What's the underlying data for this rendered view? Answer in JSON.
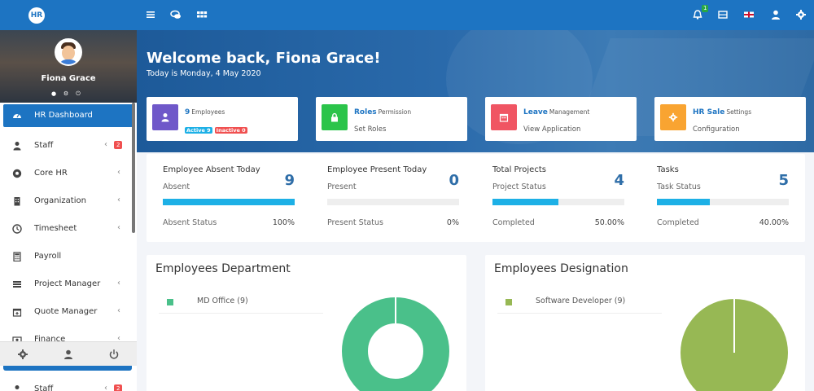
{
  "app": {
    "logo_text": "HR"
  },
  "topbar": {
    "icons": [
      "menu-icon",
      "chat-icon",
      "apps-grid-icon",
      "bell-icon",
      "layout-icon",
      "uk-flag-icon",
      "user-icon",
      "gear-icon"
    ],
    "notification_count": "1"
  },
  "user": {
    "name": "Fiona Grace"
  },
  "sidebar": {
    "items": [
      {
        "label": "HR Dashboard",
        "icon": "dashboard-icon",
        "active": true
      },
      {
        "label": "Staff",
        "icon": "user-icon",
        "badge": "2",
        "has_chevron": true
      },
      {
        "label": "Core HR",
        "icon": "soccer-icon",
        "has_chevron": true
      },
      {
        "label": "Organization",
        "icon": "building-icon",
        "has_chevron": true
      },
      {
        "label": "Timesheet",
        "icon": "clock-icon",
        "has_chevron": true
      },
      {
        "label": "Payroll",
        "icon": "calculator-icon"
      },
      {
        "label": "Project Manager",
        "icon": "tasks-icon",
        "has_chevron": true
      },
      {
        "label": "Quote Manager",
        "icon": "calendar-plus-icon",
        "has_chevron": true
      },
      {
        "label": "Finance",
        "icon": "money-icon",
        "has_chevron": true
      }
    ],
    "footer_icons": [
      "gear-icon",
      "user-icon",
      "power-icon"
    ],
    "overflow_item": {
      "label": "Staff",
      "badge": "2"
    }
  },
  "hero": {
    "welcome": "Welcome back, Fiona Grace!",
    "today": "Today is Monday, 4 May 2020"
  },
  "quick_cards": [
    {
      "title": "9",
      "title_sub": "Employees",
      "tags": [
        {
          "text": "Active 9",
          "color": "#1db0e6"
        },
        {
          "text": "Inactive 0",
          "color": "#f05050"
        }
      ],
      "icon": "user-icon",
      "color": "#6f58c9"
    },
    {
      "title": "Roles",
      "title_sub": "Permission",
      "line": "Set Roles",
      "icon": "lock-icon",
      "color": "#2bc44a"
    },
    {
      "title": "Leave",
      "title_sub": "Management",
      "line": "View Application",
      "icon": "calendar-icon",
      "color": "#f05563"
    },
    {
      "title": "HR Sale",
      "title_sub": "Settings",
      "line": "Configuration",
      "icon": "gear-icon",
      "color": "#f9a431"
    }
  ],
  "stats": [
    {
      "title": "Employee Absent Today",
      "value": "9",
      "sub": "Absent",
      "progress": 1.0,
      "foot": "Absent Status",
      "pct": "100%"
    },
    {
      "title": "Employee Present Today",
      "value": "0",
      "sub": "Present",
      "progress": 0.0,
      "foot": "Present Status",
      "pct": "0%"
    },
    {
      "title": "Total Projects",
      "value": "4",
      "sub": "Project Status",
      "progress": 0.5,
      "foot": "Completed",
      "pct": "50.00%"
    },
    {
      "title": "Tasks",
      "value": "5",
      "sub": "Task Status",
      "progress": 0.4,
      "foot": "Completed",
      "pct": "40.00%"
    }
  ],
  "panels": [
    {
      "title": "Employees Department",
      "legend": "MD Office (9)",
      "color": "#4ac08a",
      "chart": "doughnut"
    },
    {
      "title": "Employees Designation",
      "legend": "Software Developer (9)",
      "color": "#97b854",
      "chart": "pie"
    }
  ]
}
